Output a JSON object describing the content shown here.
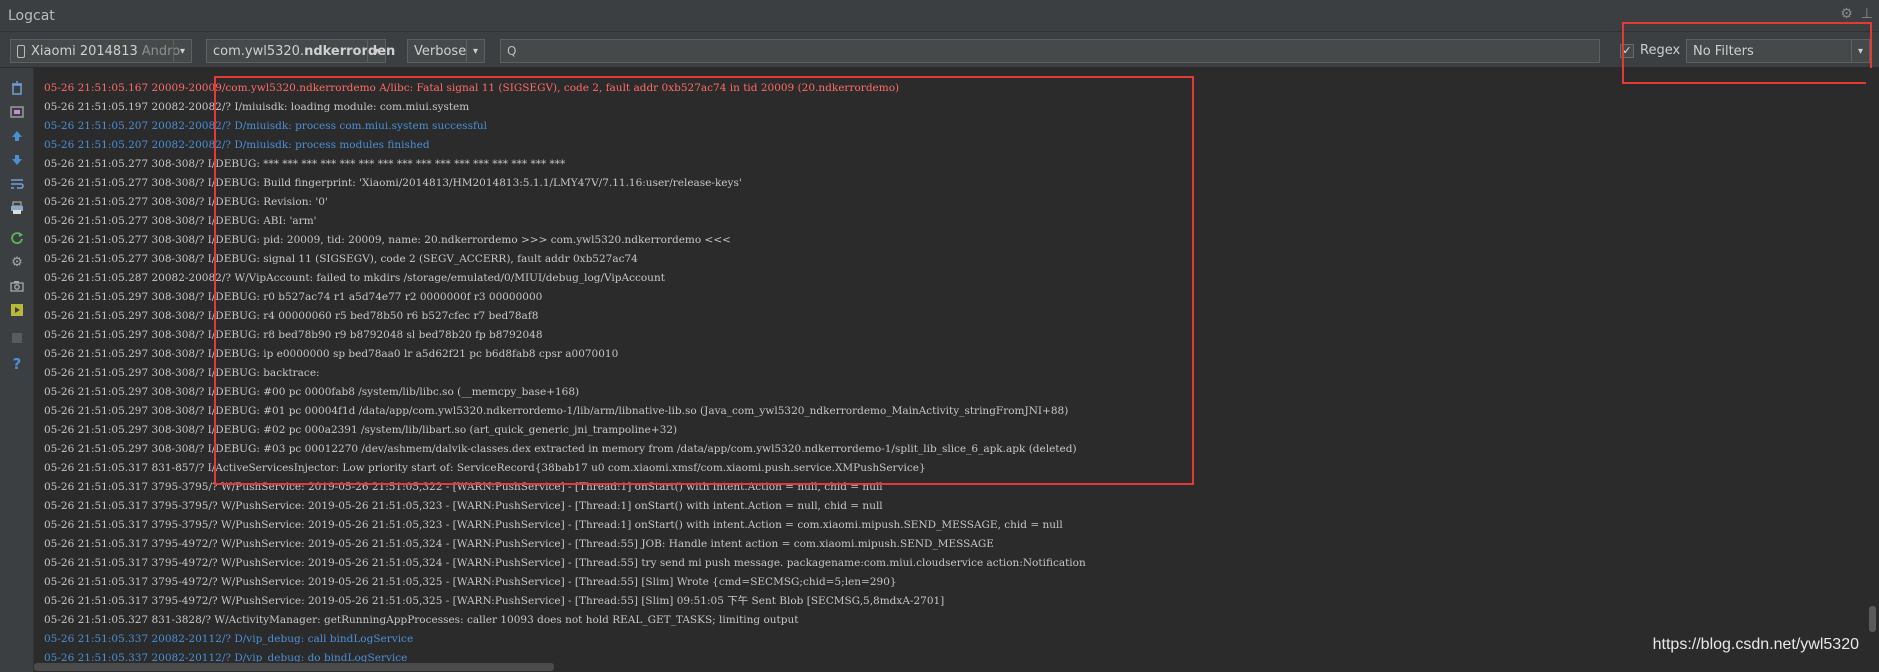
{
  "window": {
    "title": "Logcat"
  },
  "toolbar": {
    "device_name": "Xiaomi 2014813",
    "device_suffix": "Andro",
    "package_prefix": "com.ywl5320.",
    "package_bold": "ndkerrorden",
    "log_level": "Verbose",
    "search_value": "",
    "search_icon": "Q",
    "regex_label": "Regex",
    "regex_checked": "✓",
    "filter_selected": "No Filters",
    "dropdown_arrow": "▾"
  },
  "sidebar": {
    "icons": [
      "trash-icon",
      "screenshot-icon",
      "up-icon",
      "down-icon",
      "soft-wrap-icon",
      "print-icon",
      "restart-icon",
      "gear-icon",
      "camera-icon",
      "screen-record-icon",
      "stop-icon",
      "help-icon"
    ],
    "help_glyph": "?"
  },
  "colors": {
    "error": "#ff6b68",
    "debug": "#4a8fd6",
    "info": "#c7c7c7",
    "warn": "#c7c7c7",
    "highlight_box": "#e53935",
    "background": "#2b2b2b"
  },
  "log": {
    "lines": [
      {
        "text": "05-26 21:51:05.167 20009-20009/com.ywl5320.ndkerrordemo A/libc: Fatal signal 11 (SIGSEGV), code 2, fault addr 0xb527ac74 in tid 20009 (20.ndkerrordemo)",
        "level": "error"
      },
      {
        "text": "05-26 21:51:05.197 20082-20082/? I/miuisdk: loading module: com.miui.system",
        "level": "info"
      },
      {
        "text": "05-26 21:51:05.207 20082-20082/? D/miuisdk: process com.miui.system successful",
        "level": "debug"
      },
      {
        "text": "05-26 21:51:05.207 20082-20082/? D/miuisdk: process modules finished",
        "level": "debug"
      },
      {
        "text": "05-26 21:51:05.277 308-308/? I/DEBUG: *** *** *** *** *** *** *** *** *** *** *** *** *** *** *** ***",
        "level": "info"
      },
      {
        "text": "05-26 21:51:05.277 308-308/? I/DEBUG: Build fingerprint: 'Xiaomi/2014813/HM2014813:5.1.1/LMY47V/7.11.16:user/release-keys'",
        "level": "info"
      },
      {
        "text": "05-26 21:51:05.277 308-308/? I/DEBUG: Revision: '0'",
        "level": "info"
      },
      {
        "text": "05-26 21:51:05.277 308-308/? I/DEBUG: ABI: 'arm'",
        "level": "info"
      },
      {
        "text": "05-26 21:51:05.277 308-308/? I/DEBUG: pid: 20009, tid: 20009, name: 20.ndkerrordemo  >>> com.ywl5320.ndkerrordemo <<<",
        "level": "info"
      },
      {
        "text": "05-26 21:51:05.277 308-308/? I/DEBUG: signal 11 (SIGSEGV), code 2 (SEGV_ACCERR), fault addr 0xb527ac74",
        "level": "info"
      },
      {
        "text": "05-26 21:51:05.287 20082-20082/? W/VipAccount: failed to mkdirs /storage/emulated/0/MIUI/debug_log/VipAccount",
        "level": "warn"
      },
      {
        "text": "05-26 21:51:05.297 308-308/? I/DEBUG:     r0 b527ac74  r1 a5d74e77  r2 0000000f  r3 00000000",
        "level": "info"
      },
      {
        "text": "05-26 21:51:05.297 308-308/? I/DEBUG:     r4 00000060  r5 bed78b50  r6 b527cfec  r7 bed78af8",
        "level": "info"
      },
      {
        "text": "05-26 21:51:05.297 308-308/? I/DEBUG:     r8 bed78b90  r9 b8792048  sl bed78b20  fp b8792048",
        "level": "info"
      },
      {
        "text": "05-26 21:51:05.297 308-308/? I/DEBUG:     ip e0000000  sp bed78aa0  lr a5d62f21  pc b6d8fab8  cpsr a0070010",
        "level": "info"
      },
      {
        "text": "05-26 21:51:05.297 308-308/? I/DEBUG: backtrace:",
        "level": "info"
      },
      {
        "text": "05-26 21:51:05.297 308-308/? I/DEBUG:     #00 pc 0000fab8  /system/lib/libc.so (__memcpy_base+168)",
        "level": "info"
      },
      {
        "text": "05-26 21:51:05.297 308-308/? I/DEBUG:     #01 pc 00004f1d  /data/app/com.ywl5320.ndkerrordemo-1/lib/arm/libnative-lib.so (Java_com_ywl5320_ndkerrordemo_MainActivity_stringFromJNI+88)",
        "level": "info"
      },
      {
        "text": "05-26 21:51:05.297 308-308/? I/DEBUG:     #02 pc 000a2391  /system/lib/libart.so (art_quick_generic_jni_trampoline+32)",
        "level": "info"
      },
      {
        "text": "05-26 21:51:05.297 308-308/? I/DEBUG:     #03 pc 00012270  /dev/ashmem/dalvik-classes.dex extracted in memory from /data/app/com.ywl5320.ndkerrordemo-1/split_lib_slice_6_apk.apk (deleted)",
        "level": "info"
      },
      {
        "text": "05-26 21:51:05.317 831-857/? I/ActiveServicesInjector: Low priority start of: ServiceRecord{38bab17 u0 com.xiaomi.xmsf/com.xiaomi.push.service.XMPushService}",
        "level": "info"
      },
      {
        "text": "05-26 21:51:05.317 3795-3795/? W/PushService: 2019-05-26 21:51:05,322 - [WARN:PushService] - [Thread:1] onStart() with intent.Action = null, chid = null",
        "level": "warn"
      },
      {
        "text": "05-26 21:51:05.317 3795-3795/? W/PushService: 2019-05-26 21:51:05,323 - [WARN:PushService] - [Thread:1] onStart() with intent.Action = null, chid = null",
        "level": "warn"
      },
      {
        "text": "05-26 21:51:05.317 3795-3795/? W/PushService: 2019-05-26 21:51:05,323 - [WARN:PushService] - [Thread:1] onStart() with intent.Action = com.xiaomi.mipush.SEND_MESSAGE, chid = null",
        "level": "warn"
      },
      {
        "text": "05-26 21:51:05.317 3795-4972/? W/PushService: 2019-05-26 21:51:05,324 - [WARN:PushService] - [Thread:55] JOB: Handle intent action = com.xiaomi.mipush.SEND_MESSAGE",
        "level": "warn"
      },
      {
        "text": "05-26 21:51:05.317 3795-4972/? W/PushService: 2019-05-26 21:51:05,324 - [WARN:PushService] - [Thread:55] try send mi push message. packagename:com.miui.cloudservice action:Notification",
        "level": "warn"
      },
      {
        "text": "05-26 21:51:05.317 3795-4972/? W/PushService: 2019-05-26 21:51:05,325 - [WARN:PushService] - [Thread:55] [Slim] Wrote {cmd=SECMSG;chid=5;len=290}",
        "level": "warn"
      },
      {
        "text": "05-26 21:51:05.317 3795-4972/? W/PushService: 2019-05-26 21:51:05,325 - [WARN:PushService] - [Thread:55] [Slim] 09:51:05 下午 Sent  Blob [SECMSG,5,8mdxA-2701]",
        "level": "warn"
      },
      {
        "text": "05-26 21:51:05.327 831-3828/? W/ActivityManager: getRunningAppProcesses: caller 10093 does not hold REAL_GET_TASKS; limiting output",
        "level": "warn"
      },
      {
        "text": "05-26 21:51:05.337 20082-20112/? D/vip_debug: call bindLogService",
        "level": "debug"
      },
      {
        "text": "05-26 21:51:05.337 20082-20112/? D/vip_debug: do bindLogService",
        "level": "debug"
      }
    ]
  },
  "watermark": "https://blog.csdn.net/ywl5320"
}
